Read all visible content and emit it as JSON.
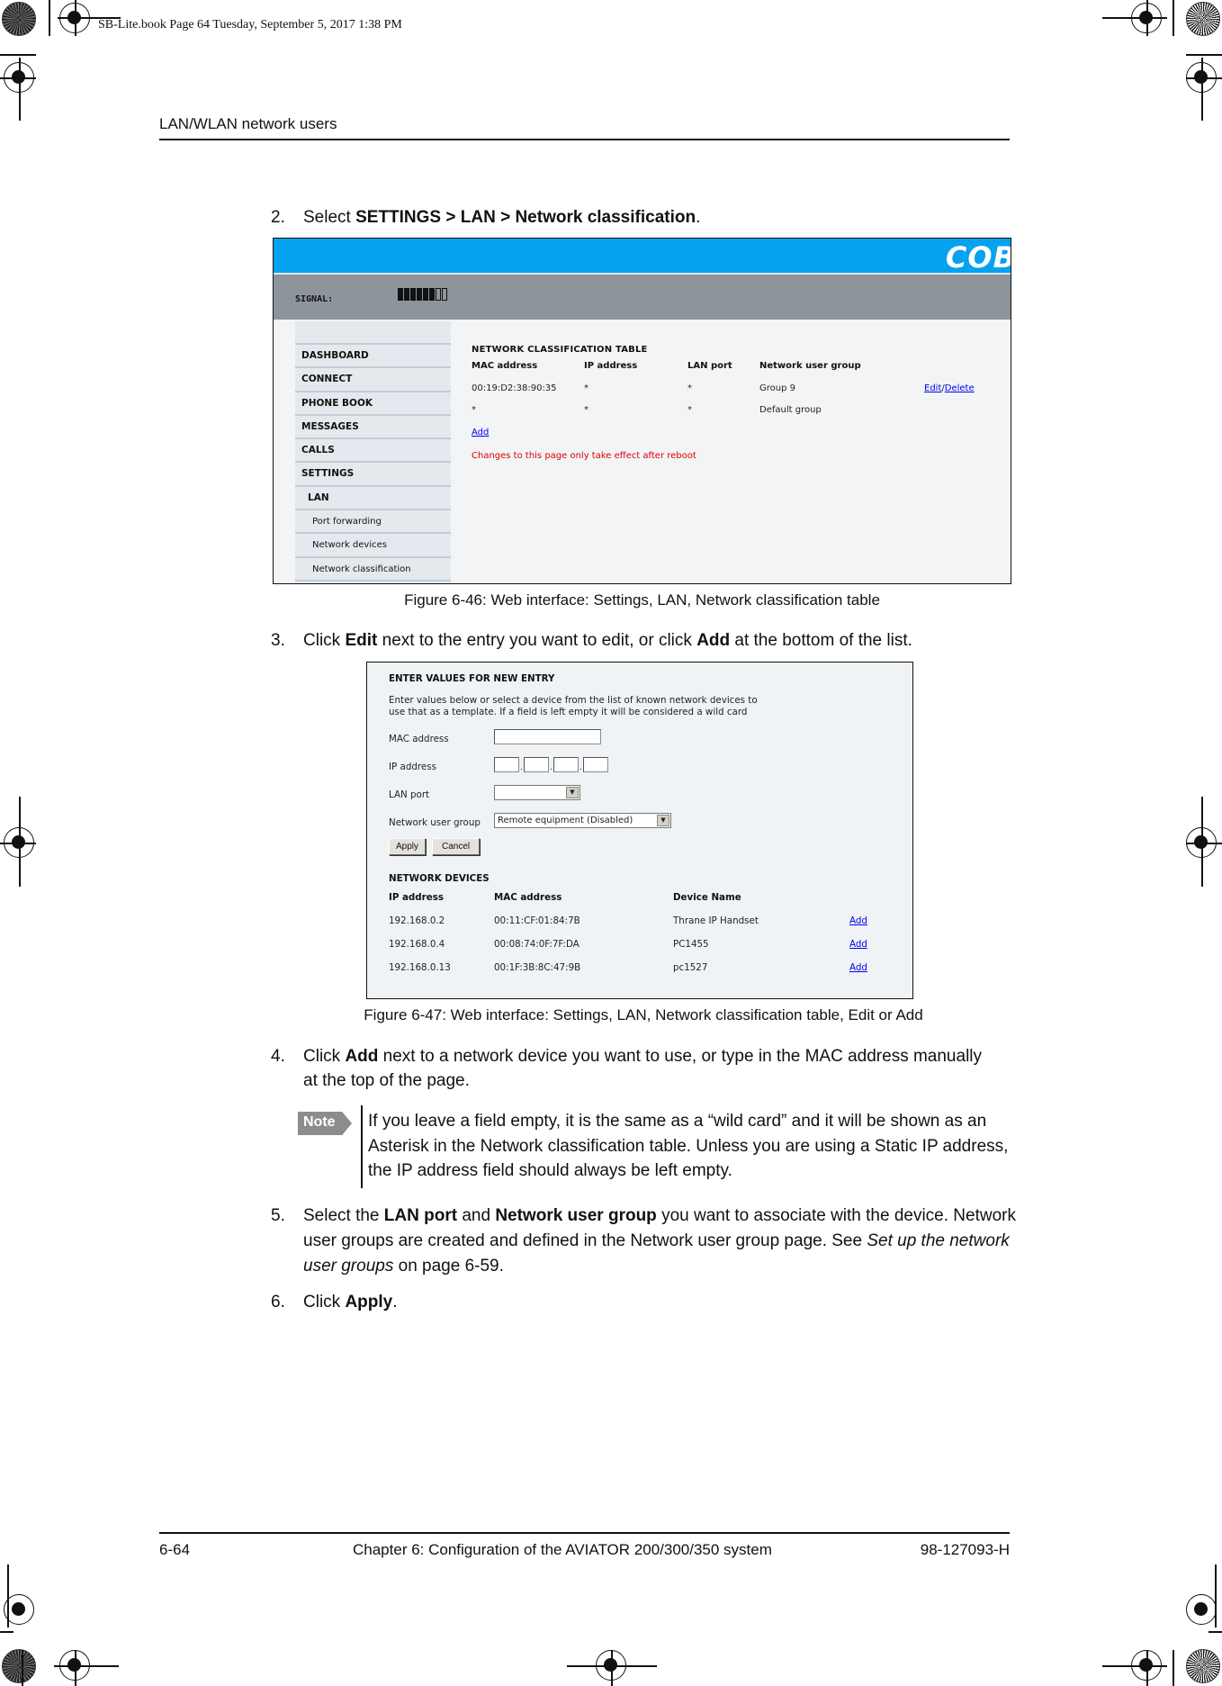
{
  "print_stamp": "SB-Lite.book  Page 64  Tuesday, September 5, 2017  1:38 PM",
  "running_head": "LAN/WLAN network users",
  "steps": {
    "s2": {
      "num": "2.",
      "pre": "Select ",
      "bold": "SETTINGS > LAN > Network classification",
      "post": "."
    },
    "s3": {
      "num": "3.",
      "pre": "Click ",
      "bold1": "Edit",
      "mid": " next to the entry you want to edit, or click ",
      "bold2": "Add",
      "post": " at the bottom of the list."
    },
    "s4": {
      "num": "4.",
      "pre": "Click ",
      "bold": "Add",
      "post": " next to a network device you want to use, or type in the MAC address manually at the top of the page."
    },
    "s5": {
      "num": "5.",
      "pre": "Select the ",
      "bold1": "LAN port",
      "mid": " and ",
      "bold2": "Network user group",
      "post": " you want to associate with the device. Network user groups are created and defined in the Network user group page. See ",
      "italic": "Set up the network user groups",
      "tail": " on page 6-59."
    },
    "s6": {
      "num": "6.",
      "pre": "Click ",
      "bold": "Apply",
      "post": "."
    }
  },
  "note": {
    "badge": "Note",
    "text": "If you leave a field empty, it is the same as a “wild card” and it will be shown as an Asterisk in the Network classification table. Unless you are using a Static IP address, the IP address field should always be left empty."
  },
  "figure1": {
    "caption": "Figure 6-46: Web interface: Settings, LAN, Network classification table",
    "logo": "COB",
    "signal_label": "SIGNAL:",
    "signal_level": {
      "filled": 6,
      "total": 8
    },
    "nav": [
      {
        "label": "DASHBOARD",
        "level": 0
      },
      {
        "label": "CONNECT",
        "level": 0
      },
      {
        "label": "PHONE BOOK",
        "level": 0
      },
      {
        "label": "MESSAGES",
        "level": 0
      },
      {
        "label": "CALLS",
        "level": 0
      },
      {
        "label": "SETTINGS",
        "level": 0
      },
      {
        "label": "LAN",
        "level": 1
      },
      {
        "label": "Port forwarding",
        "level": 2
      },
      {
        "label": "Network devices",
        "level": 2
      },
      {
        "label": "Network classification",
        "level": 2
      }
    ],
    "table_title": "NETWORK CLASSIFICATION TABLE",
    "columns": [
      "MAC address",
      "IP address",
      "LAN port",
      "Network user group"
    ],
    "rows": [
      {
        "mac": "00:19:D2:38:90:35",
        "ip": "*",
        "port": "*",
        "group": "Group 9",
        "edit": "Edit",
        "sep": "/",
        "delete": "Delete"
      },
      {
        "mac": "*",
        "ip": "*",
        "port": "*",
        "group": "Default group"
      }
    ],
    "add_link": "Add",
    "warning": "Changes to this page only take effect after reboot"
  },
  "figure2": {
    "caption": "Figure 6-47: Web interface: Settings, LAN, Network classification table, Edit or Add",
    "heading": "ENTER VALUES FOR NEW ENTRY",
    "description": "Enter values below or select a device from the list of known network devices to use that as a template. If a field is left empty it will be considered a wild card",
    "fields": {
      "mac_label": "MAC address",
      "mac_value": "",
      "ip_label": "IP address",
      "ip_octets": [
        "",
        "",
        "",
        ""
      ],
      "lan_port_label": "LAN port",
      "lan_port_value": "",
      "group_label": "Network user group",
      "group_value": "Remote equipment (Disabled)"
    },
    "apply": "Apply",
    "cancel": "Cancel",
    "devices_title": "NETWORK DEVICES",
    "device_columns": [
      "IP address",
      "MAC address",
      "Device Name"
    ],
    "devices": [
      {
        "ip": "192.168.0.2",
        "mac": "00:11:CF:01:84:7B",
        "name": "Thrane IP Handset",
        "action": "Add"
      },
      {
        "ip": "192.168.0.4",
        "mac": "00:08:74:0F:7F:DA",
        "name": "PC1455",
        "action": "Add"
      },
      {
        "ip": "192.168.0.13",
        "mac": "00:1F:3B:8C:47:9B",
        "name": "pc1527",
        "action": "Add"
      }
    ]
  },
  "footer": {
    "page": "6-64",
    "chapter": "Chapter 6:  Configuration of the AVIATOR 200/300/350 system",
    "doc_number": "98-127093-H"
  },
  "colors": {
    "header_blue": "#05a2f0",
    "signal_gray": "#8d949c",
    "link_blue": "#0000ee",
    "warning_red": "#e00000",
    "note_gray": "#8c8c8c"
  }
}
